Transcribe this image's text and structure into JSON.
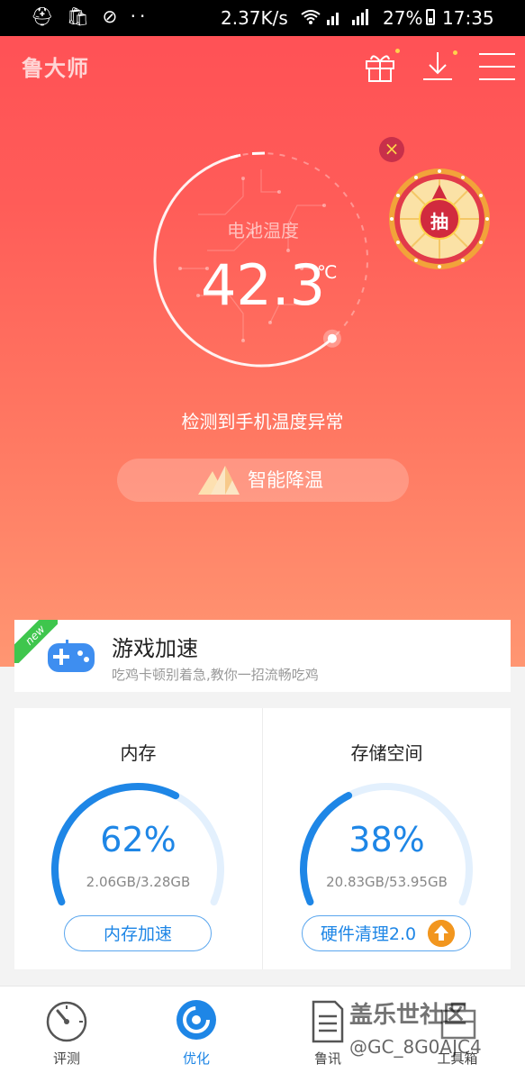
{
  "status_bar": {
    "left_icons": "⛑ 🛍 ⊘ ··",
    "speed": "2.37K/s",
    "signal": "4G 2G",
    "battery": "27%",
    "time": "17:35"
  },
  "header": {
    "logo": "鲁大师",
    "icons": [
      "gift-icon",
      "download-icon",
      "menu-icon"
    ]
  },
  "temperature": {
    "label": "电池温度",
    "value": "42.3",
    "unit": "℃",
    "warning": "检测到手机温度异常",
    "cool_button": "智能降温"
  },
  "lottery": {
    "label": "抽",
    "close": "×"
  },
  "game_boost": {
    "tag": "new",
    "title": "游戏加速",
    "subtitle": "吃鸡卡顿别着急,教你一招流畅吃鸡"
  },
  "memory": {
    "title": "内存",
    "percent": "62%",
    "percent_value": 0.62,
    "detail": "2.06GB/3.28GB",
    "button": "内存加速"
  },
  "storage": {
    "title": "存储空间",
    "percent": "38%",
    "percent_value": 0.38,
    "detail": "20.83GB/53.95GB",
    "button": "硬件清理2.0"
  },
  "nav": {
    "items": [
      {
        "label": "评测",
        "icon": "speedometer-icon"
      },
      {
        "label": "优化",
        "icon": "optimize-icon",
        "active": true
      },
      {
        "label": "鲁讯",
        "icon": "news-icon"
      },
      {
        "label": "工具箱",
        "icon": "toolbox-icon"
      }
    ]
  },
  "watermark": {
    "line1": "盖乐世社区",
    "line2": "@GC_8G0AJC4"
  },
  "colors": {
    "accent_red": "#ff5558",
    "accent_blue": "#1e86e6",
    "badge_orange": "#f2961e",
    "new_green": "#3fc64d"
  }
}
